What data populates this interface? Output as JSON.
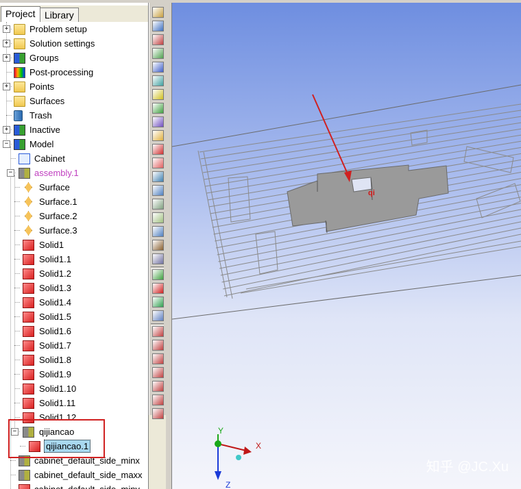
{
  "tabs": [
    {
      "label": "Project",
      "active": true
    },
    {
      "label": "Library",
      "active": false
    }
  ],
  "tree": [
    {
      "label": "Problem setup",
      "icon": "folder-icon",
      "expander": "+"
    },
    {
      "label": "Solution settings",
      "icon": "folder-icon",
      "expander": "+"
    },
    {
      "label": "Groups",
      "icon": "groups-icon",
      "expander": "+"
    },
    {
      "label": "Post-processing",
      "icon": "post-processing-icon",
      "expander": ""
    },
    {
      "label": "Points",
      "icon": "folder-icon",
      "expander": "+"
    },
    {
      "label": "Surfaces",
      "icon": "folder-icon",
      "expander": ""
    },
    {
      "label": "Trash",
      "icon": "trash-icon",
      "expander": ""
    },
    {
      "label": "Inactive",
      "icon": "inactive-icon",
      "expander": "+"
    },
    {
      "label": "Model",
      "icon": "model-icon",
      "expander": "−"
    },
    {
      "label": "Cabinet",
      "icon": "cabinet-icon",
      "expander": ""
    },
    {
      "label": "assembly.1",
      "icon": "assembly-icon",
      "expander": "−",
      "color": "#c040c0"
    },
    {
      "label": "Surface",
      "icon": "surface-icon",
      "expander": ""
    },
    {
      "label": "Surface.1",
      "icon": "surface-icon",
      "expander": ""
    },
    {
      "label": "Surface.2",
      "icon": "surface-icon",
      "expander": ""
    },
    {
      "label": "Surface.3",
      "icon": "surface-icon",
      "expander": ""
    },
    {
      "label": "Solid1",
      "icon": "solid-block-icon",
      "expander": ""
    },
    {
      "label": "Solid1.1",
      "icon": "solid-block-icon",
      "expander": ""
    },
    {
      "label": "Solid1.2",
      "icon": "solid-block-icon",
      "expander": ""
    },
    {
      "label": "Solid1.3",
      "icon": "solid-block-icon",
      "expander": ""
    },
    {
      "label": "Solid1.4",
      "icon": "solid-block-icon",
      "expander": ""
    },
    {
      "label": "Solid1.5",
      "icon": "solid-block-icon",
      "expander": ""
    },
    {
      "label": "Solid1.6",
      "icon": "solid-block-icon",
      "expander": ""
    },
    {
      "label": "Solid1.7",
      "icon": "solid-block-icon",
      "expander": ""
    },
    {
      "label": "Solid1.8",
      "icon": "solid-block-icon",
      "expander": ""
    },
    {
      "label": "Solid1.9",
      "icon": "solid-block-icon",
      "expander": ""
    },
    {
      "label": "Solid1.10",
      "icon": "solid-block-icon",
      "expander": ""
    },
    {
      "label": "Solid1.11",
      "icon": "solid-block-icon",
      "expander": ""
    },
    {
      "label": "Solid1.12",
      "icon": "solid-block-icon",
      "expander": ""
    },
    {
      "label": "qijiancao",
      "icon": "assembly-icon",
      "expander": "−"
    },
    {
      "label": "qijiancao.1",
      "icon": "solid-block-icon",
      "expander": "",
      "selected": true
    },
    {
      "label": "cabinet_default_side_minx",
      "icon": "opening-icon",
      "expander": ""
    },
    {
      "label": "cabinet_default_side_maxx",
      "icon": "opening-icon",
      "expander": ""
    },
    {
      "label": "cabinet_default_side_miny",
      "icon": "solid-block-icon",
      "expander": ""
    }
  ],
  "viewport": {
    "object_label": "qi",
    "axes": {
      "x": "X",
      "y": "Y",
      "z": "Z"
    }
  },
  "watermark": "知乎 @JC.Xu",
  "colors": {
    "highlight_box": "#d02020",
    "arrow": "#d02020",
    "selection": "#a8d8f0"
  }
}
